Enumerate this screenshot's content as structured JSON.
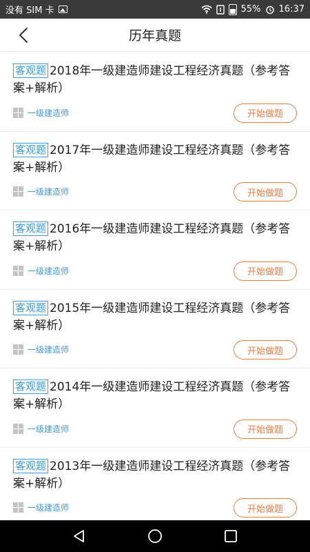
{
  "status_bar": {
    "carrier": "没有 SIM 卡",
    "battery": "55%",
    "time": "16:37"
  },
  "header": {
    "title": "历年真题"
  },
  "items": [
    {
      "tag": "客观题",
      "title": "2018年一级建造师建设工程经济真题（参考答案+解析）",
      "category": "一级建造师",
      "button": "开始做题"
    },
    {
      "tag": "客观题",
      "title": "2017年一级建造师建设工程经济真题（参考答案+解析）",
      "category": "一级建造师",
      "button": "开始做题"
    },
    {
      "tag": "客观题",
      "title": "2016年一级建造师建设工程经济真题（参考答案+解析）",
      "category": "一级建造师",
      "button": "开始做题"
    },
    {
      "tag": "客观题",
      "title": "2015年一级建造师建设工程经济真题（参考答案+解析）",
      "category": "一级建造师",
      "button": "开始做题"
    },
    {
      "tag": "客观题",
      "title": "2014年一级建造师建设工程经济真题（参考答案+解析）",
      "category": "一级建造师",
      "button": "开始做题"
    },
    {
      "tag": "客观题",
      "title": "2013年一级建造师建设工程经济真题（参考答案+解析）",
      "category": "一级建造师",
      "button": "开始做题"
    }
  ],
  "colors": {
    "accent_blue": "#3d9be0",
    "accent_orange": "#f07a3c",
    "status_bar_bg": "#3a3a3a"
  }
}
